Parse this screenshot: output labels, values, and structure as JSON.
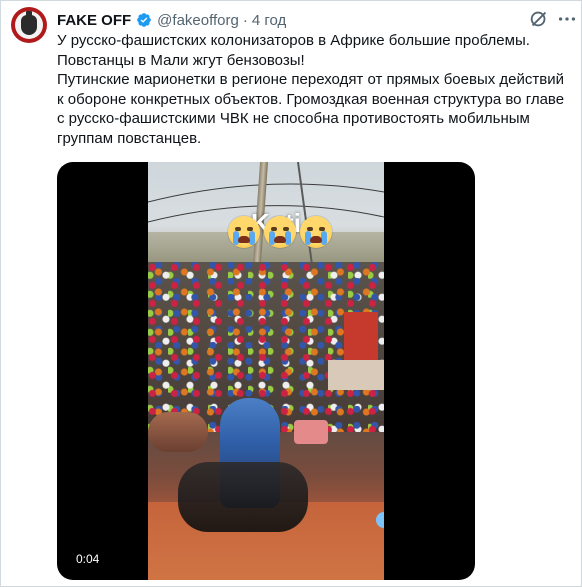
{
  "tweet": {
    "author_name": "FAKE OFF",
    "handle": "@fakeofforg",
    "separator": "·",
    "time": "4 год",
    "verified_icon": "verified-badge-icon",
    "paragraphs": [
      "У русско-фашистских колонизаторов в Африке большие проблемы.",
      "Повстанцы в Мали жгут бензовозы!",
      "Путинские марионетки в регионе переходят от прямых боевых действий к обороне конкретных объектов. Громоздкая военная структура во главе с русско-фашистскими ЧВК не способна противостоять мобильным группам повстанцев."
    ]
  },
  "media": {
    "overlay_text": "Kati",
    "emojis": [
      "crying-face-icon",
      "crying-face-icon",
      "crying-face-icon"
    ],
    "duration": "0:04"
  },
  "colors": {
    "text": "#0f1419",
    "secondary": "#536471",
    "verified": "#1d9bf0",
    "avatar_bg": "#b11a1a"
  }
}
